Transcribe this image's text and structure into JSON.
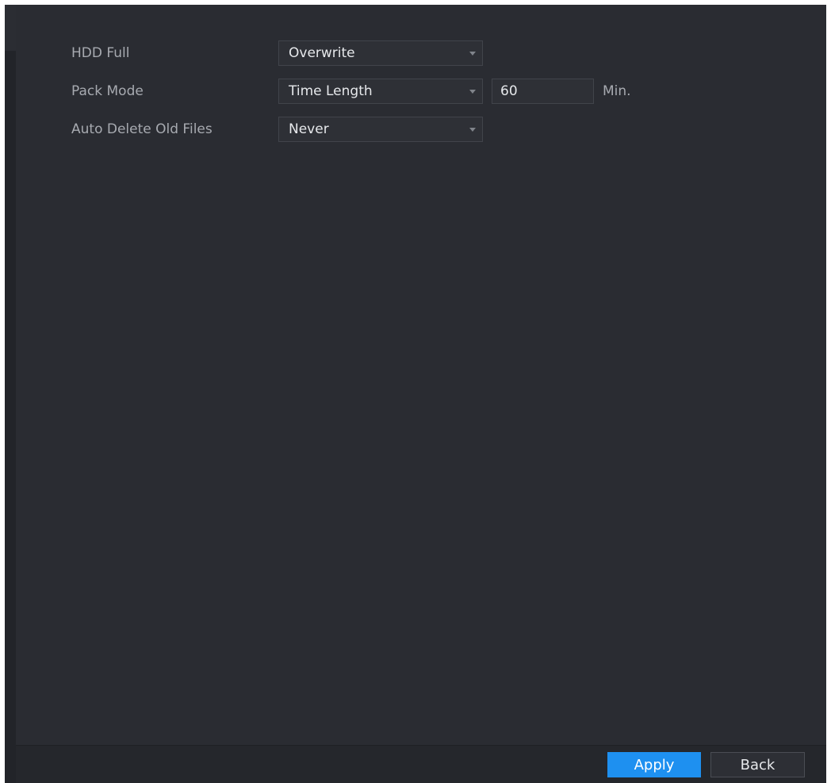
{
  "settings": {
    "hdd_full": {
      "label": "HDD Full",
      "value": "Overwrite"
    },
    "pack_mode": {
      "label": "Pack Mode",
      "value": "Time Length",
      "length_value": "60",
      "unit": "Min."
    },
    "auto_delete": {
      "label": "Auto Delete Old Files",
      "value": "Never"
    }
  },
  "footer": {
    "apply_label": "Apply",
    "back_label": "Back"
  },
  "colors": {
    "accent": "#1e90f0",
    "panel_bg": "#2a2c32"
  }
}
